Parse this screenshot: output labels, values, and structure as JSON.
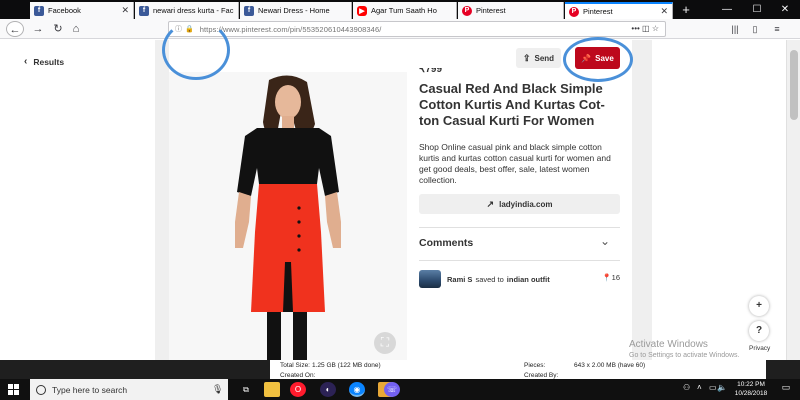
{
  "browser": {
    "tabs": [
      {
        "label": "Facebook",
        "favicon": "facebook-icon"
      },
      {
        "label": "newari dress kurta - Fac",
        "favicon": "facebook-icon"
      },
      {
        "label": "Newari Dress - Home",
        "favicon": "facebook-icon"
      },
      {
        "label": "Agar Tum Saath Ho",
        "favicon": "youtube-icon"
      },
      {
        "label": "Pinterest",
        "favicon": "pinterest-icon"
      },
      {
        "label": "Pinterest",
        "favicon": "pinterest-icon",
        "active": true
      }
    ],
    "url": "https://www.pinterest.com/pin/553520610443908346/",
    "url_menu": "•••"
  },
  "page": {
    "results_label": "Results",
    "send_label": "Send",
    "save_label": "Save",
    "price": "₹799",
    "title": "Casual Red And Black Simple Cotton Kurtis And Kurtas Cot-ton Casual Kurti For Women",
    "description": "Shop Online casual pink and black simple cotton kurtis and kurtas cotton casual kurti for women and get good deals, best offer, sale, latest women collection.",
    "link_label": "ladyindia.com",
    "comments_title": "Comments",
    "pinner": {
      "name": "Rami S",
      "action": "saved to",
      "board": "indian outfit",
      "count": "16"
    },
    "fab_plus": "+",
    "fab_help": "?",
    "privacy": "Privacy",
    "colors": {
      "save": "#bd081c",
      "highlight": "#4a90d9"
    }
  },
  "watermark": {
    "title": "Activate Windows",
    "subtitle": "Go to Settings to activate Windows."
  },
  "background_window": {
    "total_size_label": "Total Size:",
    "total_size_value": "1.25 GB (122 MB done)",
    "created_on_label": "Created On:",
    "pieces_label": "Pieces:",
    "pieces_value": "643 x 2.00 MB (have 60)",
    "created_by_label": "Created By:"
  },
  "taskbar": {
    "search_placeholder": "Type here to search",
    "time": "10:22 PM",
    "date": "10/28/2018",
    "apps": [
      "task-view-icon",
      "file-explorer-icon",
      "opera-icon",
      "eclipse-icon",
      "firefox-icon",
      "folder-icon",
      "viber-icon"
    ]
  }
}
